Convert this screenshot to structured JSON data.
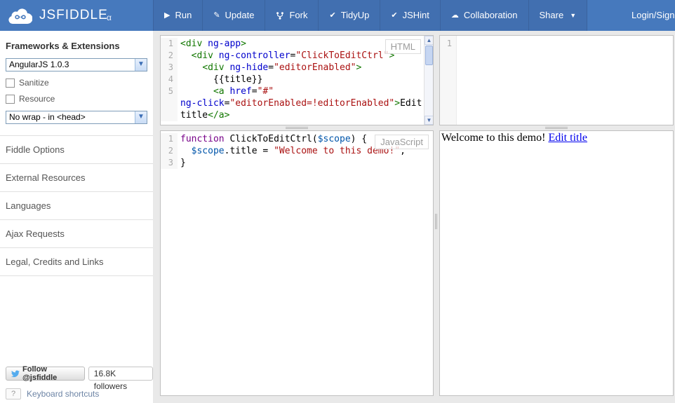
{
  "navbar": {
    "brand": "JSFIDDLE",
    "brand_suffix": "α",
    "items": [
      {
        "name": "run",
        "label": "Run",
        "icon": "run-icon"
      },
      {
        "name": "update",
        "label": "Update",
        "icon": "update-icon"
      },
      {
        "name": "fork",
        "label": "Fork",
        "icon": "fork-icon"
      },
      {
        "name": "tidyup",
        "label": "TidyUp",
        "icon": "tidyup-icon"
      },
      {
        "name": "jshint",
        "label": "JSHint",
        "icon": "jshint-icon"
      },
      {
        "name": "collaboration",
        "label": "Collaboration",
        "icon": "collaboration-icon"
      },
      {
        "name": "share",
        "label": "Share",
        "icon": "share-caret-icon",
        "caret": true
      }
    ],
    "login_label": "Login/Sign up"
  },
  "sidebar": {
    "heading": "Frameworks & Extensions",
    "framework_select": "AngularJS 1.0.3",
    "checkboxes": [
      {
        "label": "Sanitize",
        "checked": false
      },
      {
        "label": "Resource",
        "checked": false
      }
    ],
    "wrap_select": "No wrap - in <head>",
    "sections": [
      "Fiddle Options",
      "External Resources",
      "Languages",
      "Ajax Requests",
      "Legal, Credits and Links"
    ],
    "twitter": {
      "follow_label": "Follow @jsfiddle",
      "followers": "16.8K followers"
    },
    "shortcuts": {
      "key": "?",
      "label": "Keyboard shortcuts"
    }
  },
  "editors": {
    "html": {
      "label": "HTML",
      "lines": [
        {
          "n": "1",
          "t": [
            [
              "tag",
              "<div"
            ],
            [
              "pl",
              " "
            ],
            [
              "attr",
              "ng-app"
            ],
            [
              "tag",
              ">"
            ]
          ]
        },
        {
          "n": "2",
          "t": [
            [
              "pl",
              "  "
            ],
            [
              "tag",
              "<div"
            ],
            [
              "pl",
              " "
            ],
            [
              "attr",
              "ng-controller"
            ],
            [
              "pl",
              "="
            ],
            [
              "str",
              "\"ClickToEditCtrl\""
            ],
            [
              "tag",
              ">"
            ]
          ]
        },
        {
          "n": "3",
          "t": [
            [
              "pl",
              "    "
            ],
            [
              "tag",
              "<div"
            ],
            [
              "pl",
              " "
            ],
            [
              "attr",
              "ng-hide"
            ],
            [
              "pl",
              "="
            ],
            [
              "str",
              "\"editorEnabled\""
            ],
            [
              "tag",
              ">"
            ]
          ]
        },
        {
          "n": "4",
          "t": [
            [
              "pl",
              "      {{title}}"
            ]
          ]
        },
        {
          "n": "5",
          "t": [
            [
              "pl",
              "      "
            ],
            [
              "tag",
              "<a"
            ],
            [
              "pl",
              " "
            ],
            [
              "attr",
              "href"
            ],
            [
              "pl",
              "="
            ],
            [
              "str",
              "\"#\""
            ]
          ]
        },
        {
          "n": "",
          "t": [
            [
              "attr",
              "ng-click"
            ],
            [
              "pl",
              "="
            ],
            [
              "str",
              "\"editorEnabled=!editorEnabled\""
            ],
            [
              "tag",
              ">"
            ],
            [
              "pl",
              "Edit"
            ]
          ]
        },
        {
          "n": "",
          "t": [
            [
              "pl",
              "title"
            ],
            [
              "tag",
              "</a>"
            ]
          ]
        }
      ]
    },
    "js": {
      "label": "JavaScript",
      "lines": [
        {
          "n": "1",
          "t": [
            [
              "kw",
              "function"
            ],
            [
              "pl",
              " ClickToEditCtrl("
            ],
            [
              "v2",
              "$scope"
            ],
            [
              "pl",
              ") {"
            ]
          ]
        },
        {
          "n": "2",
          "t": [
            [
              "pl",
              "  "
            ],
            [
              "v2",
              "$scope"
            ],
            [
              "pl",
              ".title = "
            ],
            [
              "str",
              "\"Welcome to this demo!\""
            ],
            [
              "pl",
              ","
            ]
          ]
        },
        {
          "n": "3",
          "t": [
            [
              "pl",
              "}"
            ]
          ]
        }
      ]
    },
    "css": {
      "lines": [
        {
          "n": "1",
          "t": []
        }
      ]
    }
  },
  "result": {
    "text": "Welcome to this demo! ",
    "link": "Edit title"
  },
  "colors": {
    "navbar": "#4679bd",
    "nav_item": "#416fb0",
    "link": "#0000ee",
    "tag": "#117700",
    "attribute": "#0000cc",
    "string": "#aa1111",
    "keyword": "#770088",
    "twitter": "#55acee"
  }
}
